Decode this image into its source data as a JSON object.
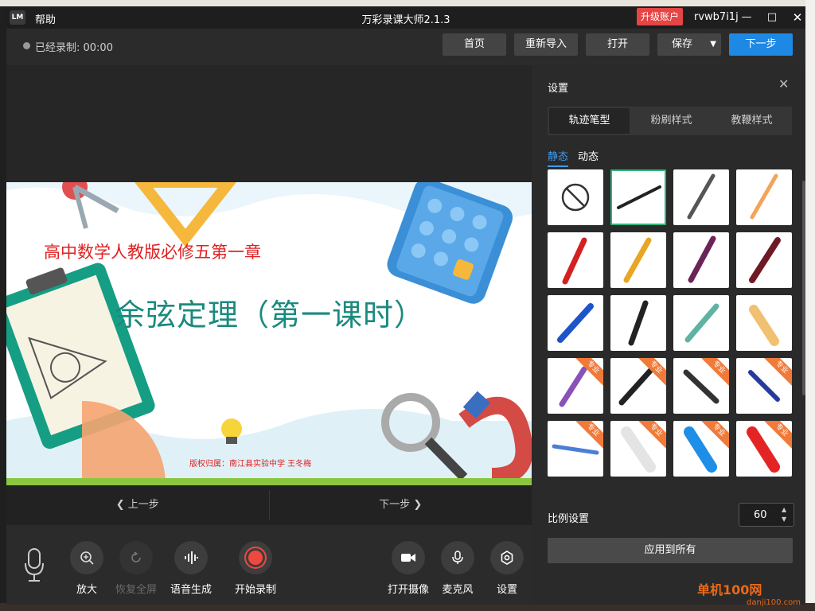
{
  "window": {
    "logo": "LM",
    "help_menu": "帮助",
    "title": "万彩录课大师2.1.3",
    "upgrade": "升级账户",
    "username": "rvwb7i1j"
  },
  "toolbar": {
    "recorded_label": "已经录制: 00:00",
    "home": "首页",
    "reimport": "重新导入",
    "open": "打开",
    "save": "保存",
    "next": "下一步"
  },
  "slide": {
    "subtitle": "高中数学人教版必修五第一章",
    "title": "余弦定理（第一课时）",
    "credit": "版权归属：南江县实验中学  王冬梅"
  },
  "nav": {
    "prev": "上一步",
    "next": "下一步"
  },
  "bottom": {
    "zoom_in": "放大",
    "restore": "恢复全屏",
    "voice_gen": "语音生成",
    "start_record": "开始录制",
    "open_camera": "打开摄像",
    "microphone": "麦克风",
    "settings": "设置"
  },
  "panel": {
    "title": "设置",
    "tabs": [
      "轨迹笔型",
      "粉刷样式",
      "教鞭样式"
    ],
    "subtabs": [
      "静态",
      "动态"
    ],
    "pro_tag": "专业",
    "ratio_label": "比例设置",
    "ratio_value": "60",
    "apply": "应用到所有"
  },
  "watermark": {
    "site": "单机100网",
    "url": "danji100.com"
  },
  "colors": {
    "accent": "#1e88e5",
    "upgrade": "#e54545",
    "selected": "#2fb37a",
    "pro": "#f07a3a"
  }
}
